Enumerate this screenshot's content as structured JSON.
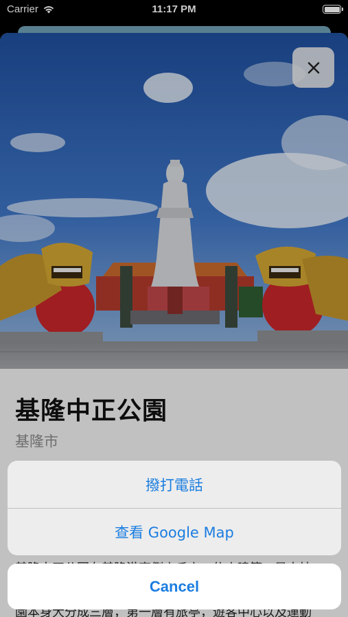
{
  "status_bar": {
    "carrier": "Carrier",
    "time": "11:17 PM"
  },
  "detail": {
    "title": "基隆中正公園",
    "city": "基隆市",
    "description": "基隆中正公園在基隆港東側山丘上，依山建築，是本扶\n園本身大分成三層，第一層有旅亭，遊客中心以及運動"
  },
  "action_sheet": {
    "items": [
      {
        "label": "撥打電話"
      },
      {
        "label": "查看 Google Map"
      }
    ],
    "cancel_label": "Cancel"
  },
  "colors": {
    "accent": "#1a7de0"
  },
  "icons": {
    "close": "close-icon",
    "wifi": "wifi-icon",
    "battery": "battery-icon"
  }
}
